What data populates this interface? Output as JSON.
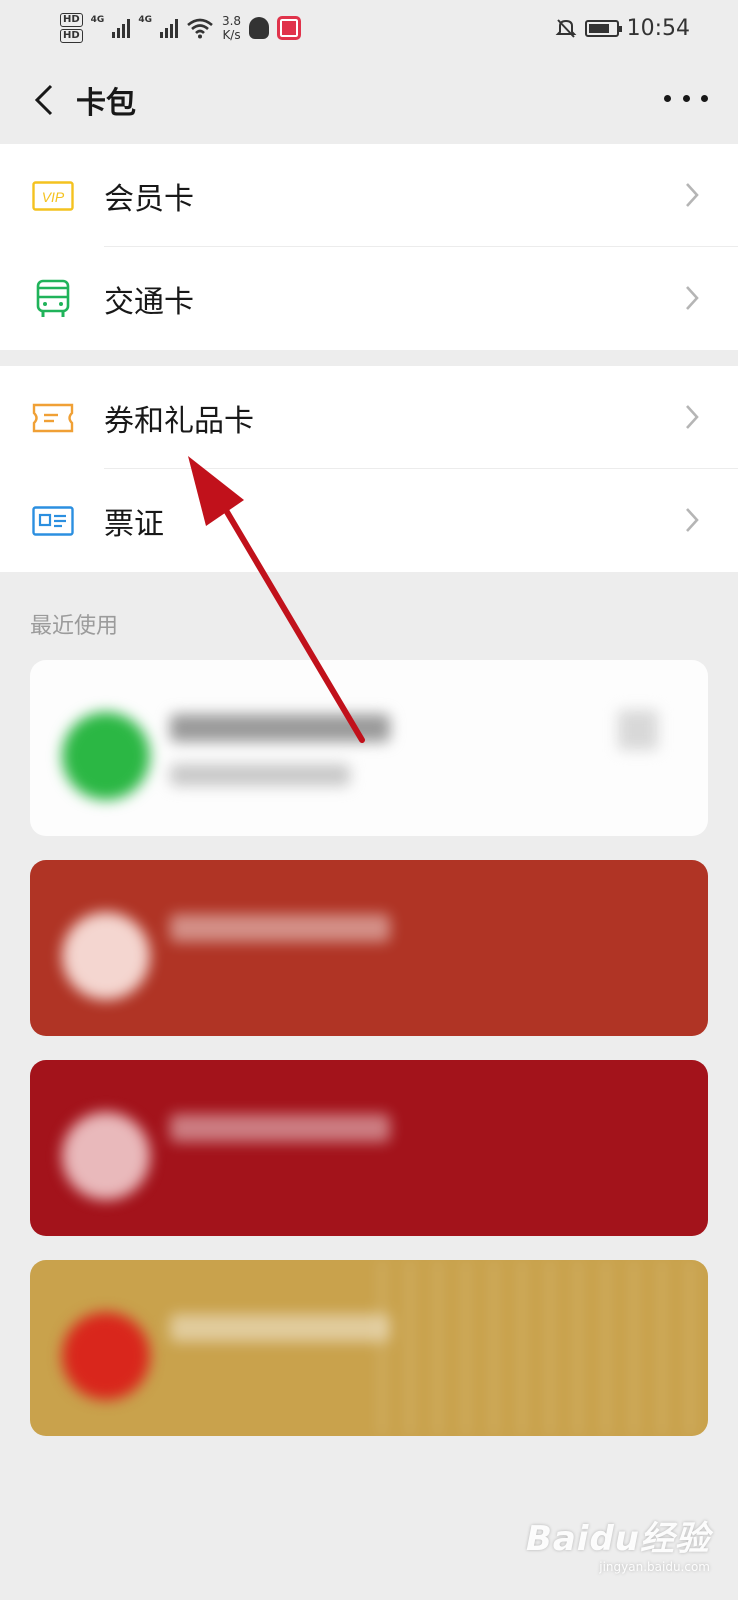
{
  "status_bar": {
    "hd1": "HD",
    "hd2": "HD",
    "net1": "4G",
    "net2": "4G",
    "speed_value": "3.8",
    "speed_unit": "K/s",
    "time": "10:54"
  },
  "nav": {
    "title": "卡包"
  },
  "menu": {
    "group1": [
      {
        "label": "会员卡",
        "icon": "vip-icon"
      },
      {
        "label": "交通卡",
        "icon": "bus-icon"
      }
    ],
    "group2": [
      {
        "label": "券和礼品卡",
        "icon": "ticket-icon"
      },
      {
        "label": "票证",
        "icon": "id-card-icon"
      }
    ]
  },
  "recent": {
    "section_title": "最近使用"
  },
  "colors": {
    "vip_icon": "#f4c21f",
    "bus_icon": "#20b35a",
    "ticket_icon": "#f0a035",
    "id_icon": "#2b8fe0",
    "card1_logo": "#2bb744",
    "card2_bg": "#b03425",
    "card3_bg": "#a3131b",
    "card4_bg": "#c9a24c",
    "arrow": "#c1111b"
  },
  "watermark": {
    "brand": "Baidu经验",
    "site": "jingyan.baidu.com"
  }
}
